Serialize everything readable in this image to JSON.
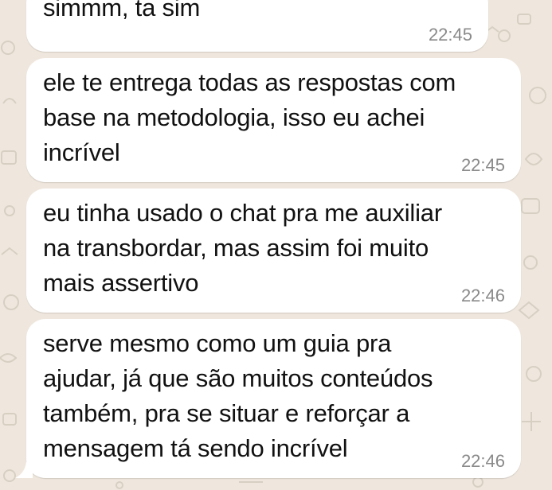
{
  "chat": {
    "wallpaper_color": "#efe7dd",
    "bubble_color": "#ffffff",
    "messages": [
      {
        "text": "simmm, ta sim",
        "time": "22:45"
      },
      {
        "text": "ele te entrega todas as respostas com\nbase na metodologia, isso eu achei\nincrível",
        "time": "22:45"
      },
      {
        "text": "eu tinha usado o chat pra me auxiliar\nna transbordar, mas assim foi muito\nmais assertivo",
        "time": "22:46"
      },
      {
        "text": "serve mesmo como um guia pra\najudar, já que são muitos conteúdos\ntambém, pra se situar e reforçar a\nmensagem tá sendo incrível",
        "time": "22:46"
      }
    ]
  }
}
